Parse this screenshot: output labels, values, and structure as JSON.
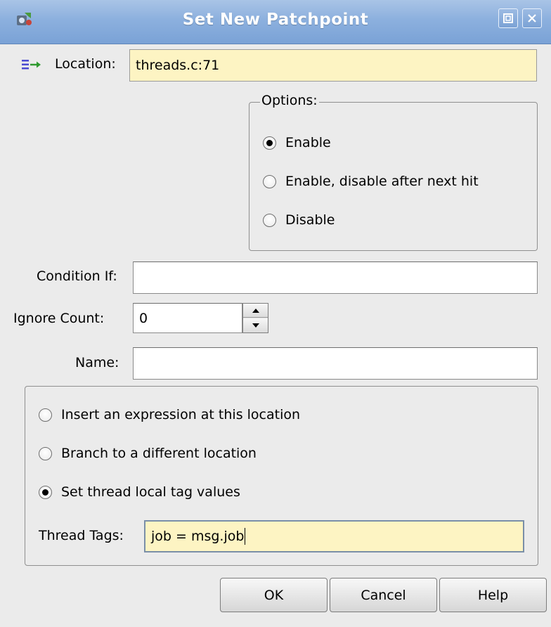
{
  "window": {
    "title": "Set New Patchpoint"
  },
  "location": {
    "label": "Location:",
    "value": "threads.c:71"
  },
  "options": {
    "title": "Options:",
    "items": [
      {
        "label": "Enable",
        "selected": true
      },
      {
        "label": "Enable, disable after next hit",
        "selected": false
      },
      {
        "label": "Disable",
        "selected": false
      }
    ]
  },
  "condition": {
    "label": "Condition If:",
    "value": ""
  },
  "ignore_count": {
    "label": "Ignore Count:",
    "value": "0"
  },
  "name": {
    "label": "Name:",
    "value": ""
  },
  "action": {
    "items": [
      {
        "label": "Insert an expression at this location",
        "selected": false
      },
      {
        "label": "Branch to a different location",
        "selected": false
      },
      {
        "label": "Set thread local tag values",
        "selected": true
      }
    ],
    "thread_tags_label": "Thread Tags:",
    "thread_tags_value": "job = msg.job"
  },
  "buttons": {
    "ok": "OK",
    "cancel": "Cancel",
    "help": "Help"
  },
  "colors": {
    "titlebar": "#8cb0de",
    "field_highlight": "#fdf4c3",
    "window_bg": "#ebebeb"
  }
}
